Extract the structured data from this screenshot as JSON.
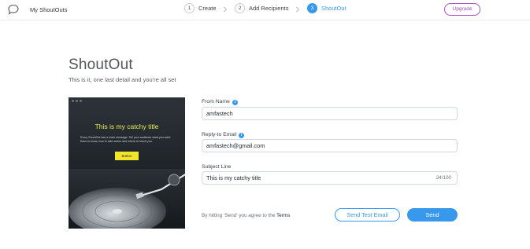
{
  "header": {
    "app_title": "My ShoutOuts",
    "logo_icon": "speech-bubble-icon",
    "steps": [
      {
        "number": "1",
        "label": "Create",
        "active": false
      },
      {
        "number": "2",
        "label": "Add Recipients",
        "active": false
      },
      {
        "number": "3",
        "label": "ShoutOut",
        "active": true
      }
    ],
    "upgrade_label": "Upgrade"
  },
  "main": {
    "title": "ShoutOut",
    "subtitle": "This is it, one last detail and you're all set"
  },
  "preview": {
    "headline": "This is my catchy title",
    "body": "Every ShoutOut has a main message. Tell your audience what you want them to know, how to take action and where to reach you.",
    "button_label": "Button"
  },
  "form": {
    "from_name": {
      "label": "From Name",
      "value": "amfastech"
    },
    "reply_to": {
      "label": "Reply-to Email",
      "value": "amfastech@gmail.com"
    },
    "subject": {
      "label": "Subject Line",
      "value": "This is my catchy title",
      "counter": "24/100"
    }
  },
  "footer": {
    "terms_text": "By hitting 'Send' you agree to the",
    "terms_link": "Terms",
    "test_email_label": "Send Test Email",
    "send_label": "Send"
  },
  "colors": {
    "accent": "#3899ec",
    "upgrade": "#aa4dc8",
    "headline": "#e9ee5a",
    "preview_button": "#f2e62b"
  }
}
